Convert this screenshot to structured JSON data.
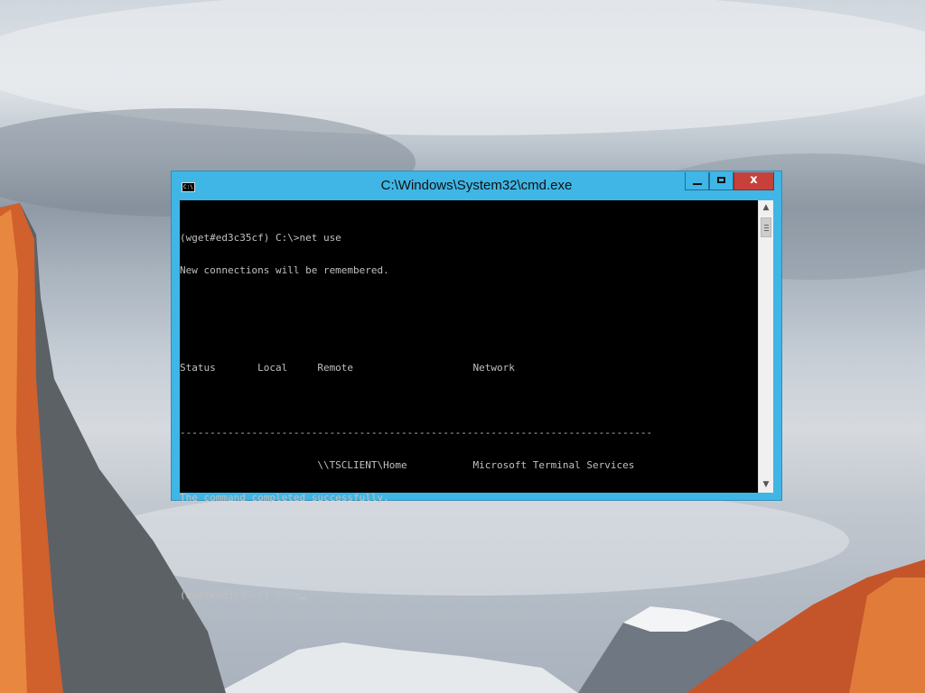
{
  "window": {
    "title": "C:\\Windows\\System32\\cmd.exe",
    "icon_label": "C:\\",
    "close_glyph": "x"
  },
  "console": {
    "lines": [
      "(wget#ed3c35cf) C:\\>net use",
      "New connections will be remembered.",
      "",
      "",
      "Status       Local     Remote                    Network",
      "",
      "-------------------------------------------------------------------------------",
      "                       \\\\TSCLIENT\\Home           Microsoft Terminal Services",
      "The command completed successfully.",
      "",
      "",
      "(wget#ed3c35cf) C:\\>"
    ]
  },
  "scrollbar": {
    "up_arrow": "▲",
    "down_arrow": "▼"
  }
}
